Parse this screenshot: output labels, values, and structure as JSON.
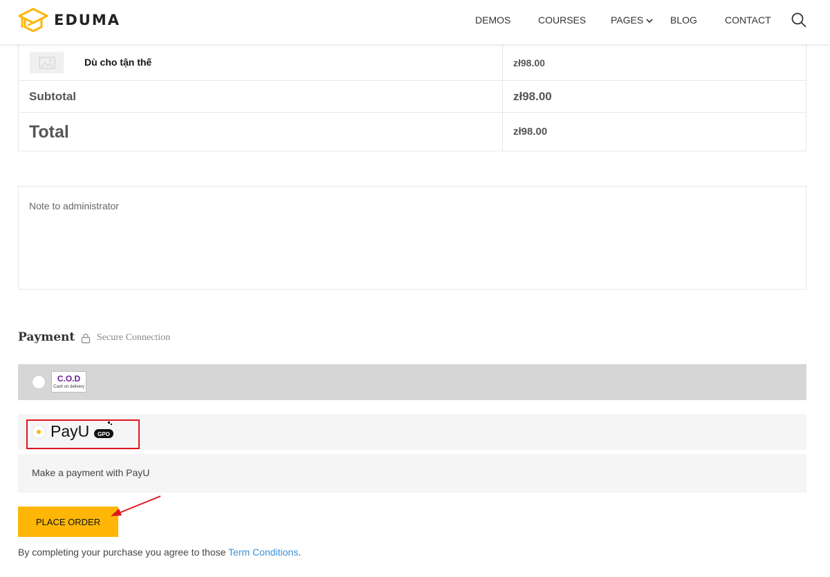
{
  "brand": {
    "name": "EDUMA",
    "accent": "#ffb606"
  },
  "nav": {
    "items": [
      "DEMOS",
      "COURSES",
      "PAGES",
      "BLOG",
      "CONTACT"
    ],
    "search_icon": "magnifier-icon"
  },
  "order": {
    "product": {
      "name": "Dù cho tận thế",
      "price": "zł98.00"
    },
    "subtotal": {
      "label": "Subtotal",
      "value": "zł98.00"
    },
    "total": {
      "label": "Total",
      "value": "zł98.00"
    }
  },
  "note": {
    "placeholder": "Note to administrator"
  },
  "payment": {
    "title": "Payment",
    "secure": "Secure Connection",
    "cod": {
      "logo_big": "C.O.D",
      "logo_small": "Cash on delivery"
    },
    "payu": {
      "logo": "PayU",
      "badge": "GPO",
      "description": "Make a payment with PayU"
    }
  },
  "actions": {
    "place_order": "PLACE ORDER"
  },
  "agreement": {
    "text": "By completing your purchase you agree to those ",
    "link": "Term Conditions",
    "tail": "."
  },
  "colors": {
    "highlight": "#e0141e",
    "link": "#3a8fd6",
    "cod_bg": "#d6d6d6",
    "payu_bg": "#f5f5f5"
  }
}
